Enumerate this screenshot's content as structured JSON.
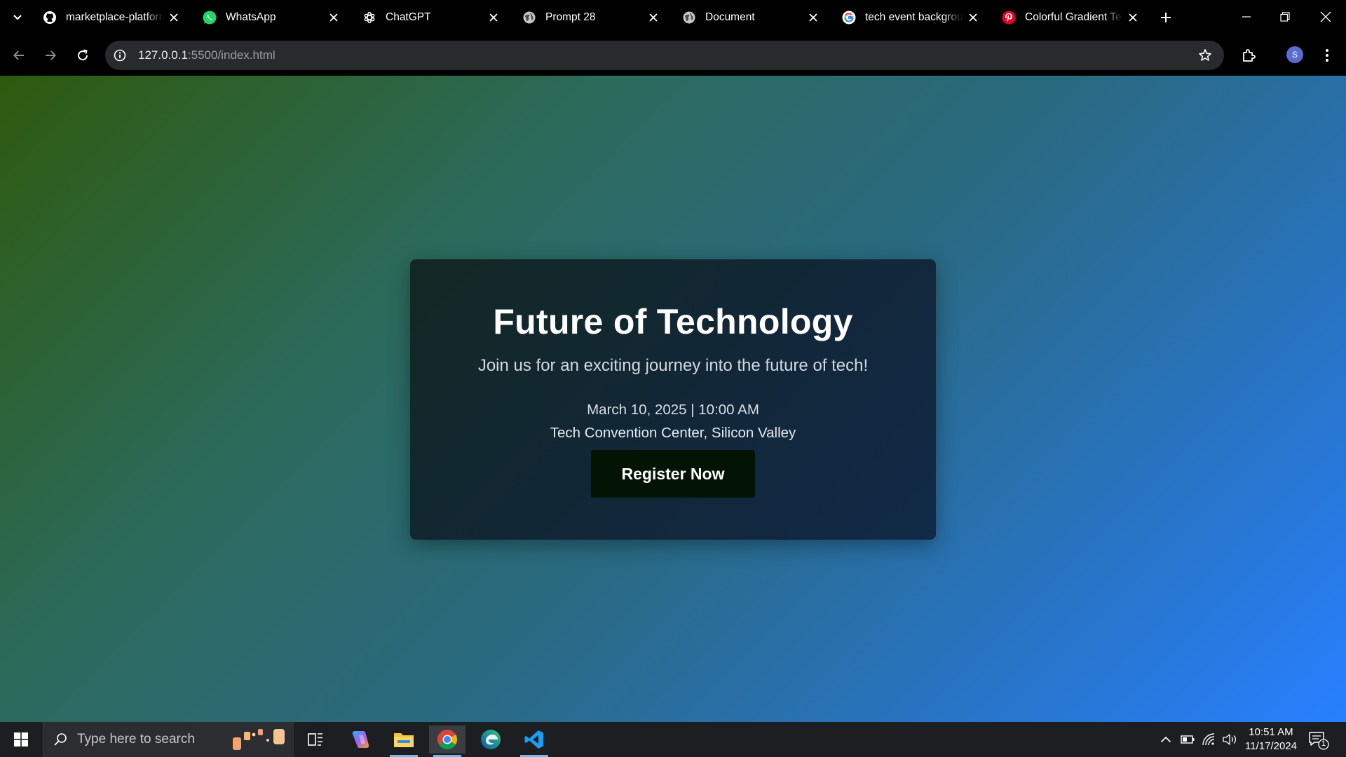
{
  "browser": {
    "tabs": [
      {
        "title": "marketplace-platform",
        "favicon": "github-icon"
      },
      {
        "title": "WhatsApp",
        "favicon": "whatsapp-icon"
      },
      {
        "title": "ChatGPT",
        "favicon": "chatgpt-icon"
      },
      {
        "title": "Prompt 28",
        "favicon": "globe-icon"
      },
      {
        "title": "Document",
        "favicon": "globe-icon"
      },
      {
        "title": "tech event background",
        "favicon": "google-icon"
      },
      {
        "title": "Colorful Gradient Tech",
        "favicon": "pinterest-icon"
      }
    ],
    "address": {
      "host": "127.0.0.1",
      "path": ":5500/index.html"
    },
    "profile_initial": "S"
  },
  "page": {
    "title": "Future of Technology",
    "subtitle": "Join us for an exciting journey into the future of tech!",
    "date_time": "March 10, 2025 | 10:00 AM",
    "venue": "Tech Convention Center, Silicon Valley",
    "register_label": "Register Now"
  },
  "taskbar": {
    "search_placeholder": "Type here to search",
    "time": "10:51 AM",
    "date": "11/17/2024",
    "notification_count": "1",
    "apps": [
      "task-view-icon",
      "copilot-icon",
      "file-explorer-icon",
      "chrome-icon",
      "edge-icon",
      "vscode-icon"
    ]
  },
  "colors": {
    "gradient_start": "#2e5a0e",
    "gradient_end": "#2880ff",
    "card_bg": "#12273a",
    "button_bg": "#041404"
  }
}
